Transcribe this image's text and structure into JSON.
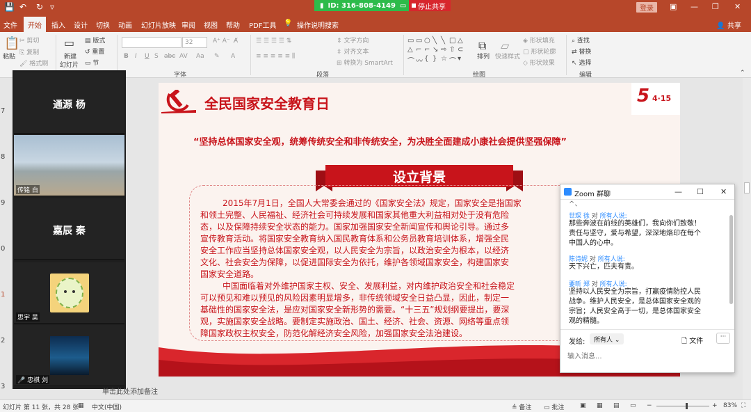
{
  "titlebar": {
    "zoom_meeting_id": "ID: 316-808-4149",
    "stop_share_label": "停止共享",
    "login_label": "登录"
  },
  "tabs": [
    "文件",
    "开始",
    "插入",
    "设计",
    "切换",
    "动画",
    "幻灯片放映",
    "审阅",
    "视图",
    "帮助",
    "PDF工具"
  ],
  "tell_me": "操作说明搜索",
  "share": "共享",
  "ribbon": {
    "paste": "粘贴",
    "cut": "剪切",
    "copy": "复制",
    "format_painter": "格式刷",
    "new_slide": "新建",
    "new_slide_2": "幻灯片",
    "layout": "版式",
    "reset": "重置",
    "section": "节",
    "font_size": "32",
    "font_group": "字体",
    "text_direction": "文字方向",
    "align_text": "对齐文本",
    "smartart": "转换为 SmartArt",
    "paragraph_group": "段落",
    "arrange": "排列",
    "quick_styles": "快速样式",
    "shape_fill": "形状填充",
    "shape_outline": "形状轮廓",
    "shape_effects": "形状效果",
    "drawing_group": "绘图",
    "find": "查找",
    "replace": "替换",
    "select": "选择",
    "editing_group": "编辑"
  },
  "slide_numbers": [
    "7",
    "8",
    "9",
    "0",
    "1",
    "2",
    "3"
  ],
  "gallery": {
    "tiles": [
      {
        "name": "通源 杨"
      },
      {
        "name": "传铭 白"
      },
      {
        "name": "嘉辰 秦"
      },
      {
        "name": "思宇 吴"
      },
      {
        "name": "忠祺 刘"
      }
    ]
  },
  "slide": {
    "title": "全民国家安全教育日",
    "logo_text": "4·15",
    "quote": "“坚持总体国家安全观，统筹传统安全和非传统安全，为决胜全面建成小康社会提供坚强保障”",
    "banner": "设立背景",
    "p1_l1": "2015年7月1日，全国人大常委会通过的《国家安全法》规定，国家安全是指国家",
    "p1_l2": "和领土完整、人民福祉、经济社会可持续发展和国家其他重大利益相对处于没有危险",
    "p1_l3": "态，以及保障持续安全状态的能力。国家加强国家安全新闻宣传和舆论引导。通过多",
    "p1_l4": "宣传教育活动。将国家安全教育纳入国民教育体系和公务员教育培训体系，增强全民",
    "p1_l5": "安全工作应当坚持总体国家安全观，以人民安全为宗旨，以政治安全为根本，以经济",
    "p1_l6": "文化、社会安全为保障，以促进国际安全为依托，维护各领域国家安全，构建国家安",
    "p1_l7": "国家安全道路。",
    "p2_l1": "中国面临着对外维护国家主权、安全、发展利益，对内维护政治安全和社会稳定",
    "p2_l2": "可以预见和难以预见的风险因素明显增多，非传统领域安全日益凸显，因此，制定一",
    "p2_l3": "基础性的国家安全法，是应对国家安全新形势的需要。“十三五”规划纲要提出，要深",
    "p2_l4": "观，实施国家安全战略。要制定实施政治、国土、经济、社会、资源、网络等重点领",
    "p2_l5": "障国家政权主权安全，防范化解经济安全风险，加强国家安全法治建设。"
  },
  "notes_hint": "单击此处添加备注",
  "chat": {
    "title": "Zoom 群聊",
    "top_snippet": "^、",
    "to_word": "对",
    "messages": [
      {
        "sender": "世琛 徐",
        "target": "所有人说:",
        "lines": [
          "那些奔波在前线的英雄们，我向你们致敬！",
          "责任与坚守，爱与希望，深深地烙印在每个",
          "中国人的心中。"
        ]
      },
      {
        "sender": "陈诗妮",
        "target": "所有人说:",
        "lines": [
          "天下兴亡，匹夫有责。"
        ]
      },
      {
        "sender": "要昕 郑",
        "target": "所有人说:",
        "lines": [
          "坚持以人民安全为宗旨，打赢疫情防控人民",
          "战争。维护人民安全，是总体国家安全观的",
          "宗旨；人民安全高于一切，是总体国家安全",
          "观的精髓。"
        ]
      }
    ],
    "send_to_label": "发给:",
    "recipient": "所有人",
    "file_label": "文件",
    "more": "···",
    "input_placeholder": "输入消息..."
  },
  "statusbar": {
    "slide_info": "幻灯片 第 11 张，共 28 张",
    "language": "中文(中国)",
    "notes": "备注",
    "comments": "批注",
    "zoom_level": "83%"
  },
  "colors": {
    "ppt_accent": "#b7472a",
    "slide_red": "#c8141b",
    "zoom_green": "#2dbb4a",
    "zoom_blue": "#2d8cff"
  }
}
